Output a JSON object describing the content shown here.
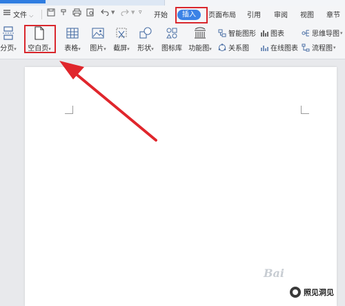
{
  "menubar": {
    "file_label": "文件",
    "tabs": [
      "开始",
      "插入",
      "页面布局",
      "引用",
      "审阅",
      "视图",
      "章节"
    ],
    "active_tab": "插入"
  },
  "ribbon": {
    "page_break": "分页",
    "blank_page": "空白页",
    "table": "表格",
    "picture": "图片",
    "screenshot": "截屏",
    "shapes": "形状",
    "icon_library": "图标库",
    "function_chart": "功能图",
    "smart_graphic": "智能图形",
    "chart": "图表",
    "mind_map": "思维导图",
    "relation_chart": "关系图",
    "online_chart": "在线图表",
    "flowchart": "流程图"
  },
  "watermark": {
    "text": "Bai",
    "brand": "照见洞见"
  },
  "colors": {
    "accent": "#3b82e6",
    "annotation_red": "#d9262c"
  }
}
